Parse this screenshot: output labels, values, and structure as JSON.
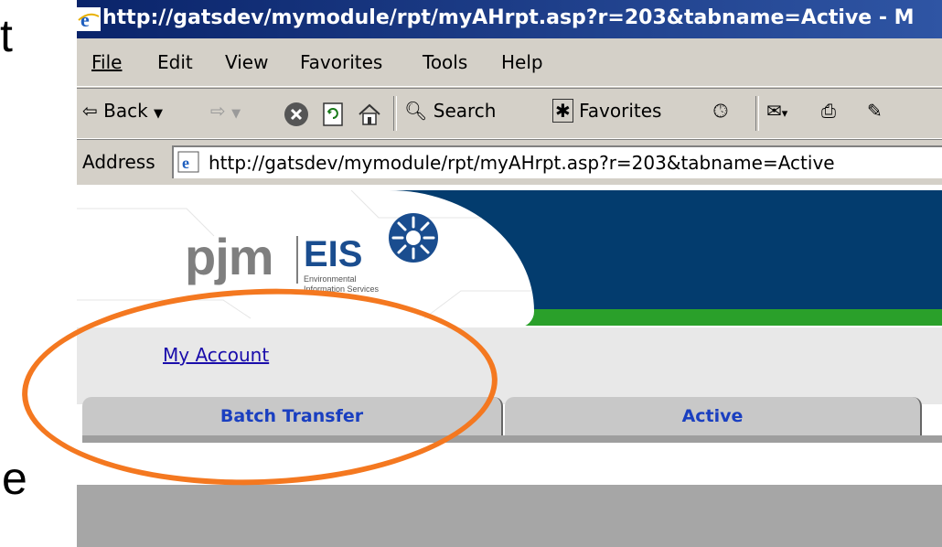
{
  "slide": {
    "fragment_top": "t",
    "fragment_bottom": "e"
  },
  "browser": {
    "title": "http://gatsdev/mymodule/rpt/myAHrpt.asp?r=203&tabname=Active - M",
    "menu": [
      "File",
      "Edit",
      "View",
      "Favorites",
      "Tools",
      "Help"
    ],
    "menu_underline_index": [
      0,
      0,
      0,
      1,
      0,
      0
    ],
    "toolbar": {
      "back_label": "Back",
      "search_label": "Search",
      "favorites_label": "Favorites"
    },
    "address_label": "Address",
    "url": "http://gatsdev/mymodule/rpt/myAHrpt.asp?r=203&tabname=Active"
  },
  "page": {
    "brand": "pjm",
    "product": "EIS",
    "product_sub": [
      "Environmental",
      "Information Services"
    ],
    "account_link": "My Account",
    "tabs": [
      {
        "label": "Batch Transfer"
      },
      {
        "label": "Active"
      }
    ]
  },
  "colors": {
    "title_bar": "#0a246a",
    "header_navy": "#033c6e",
    "header_green": "#2aa02a",
    "tab_text": "#1a3fc0",
    "highlight": "#f47820"
  }
}
